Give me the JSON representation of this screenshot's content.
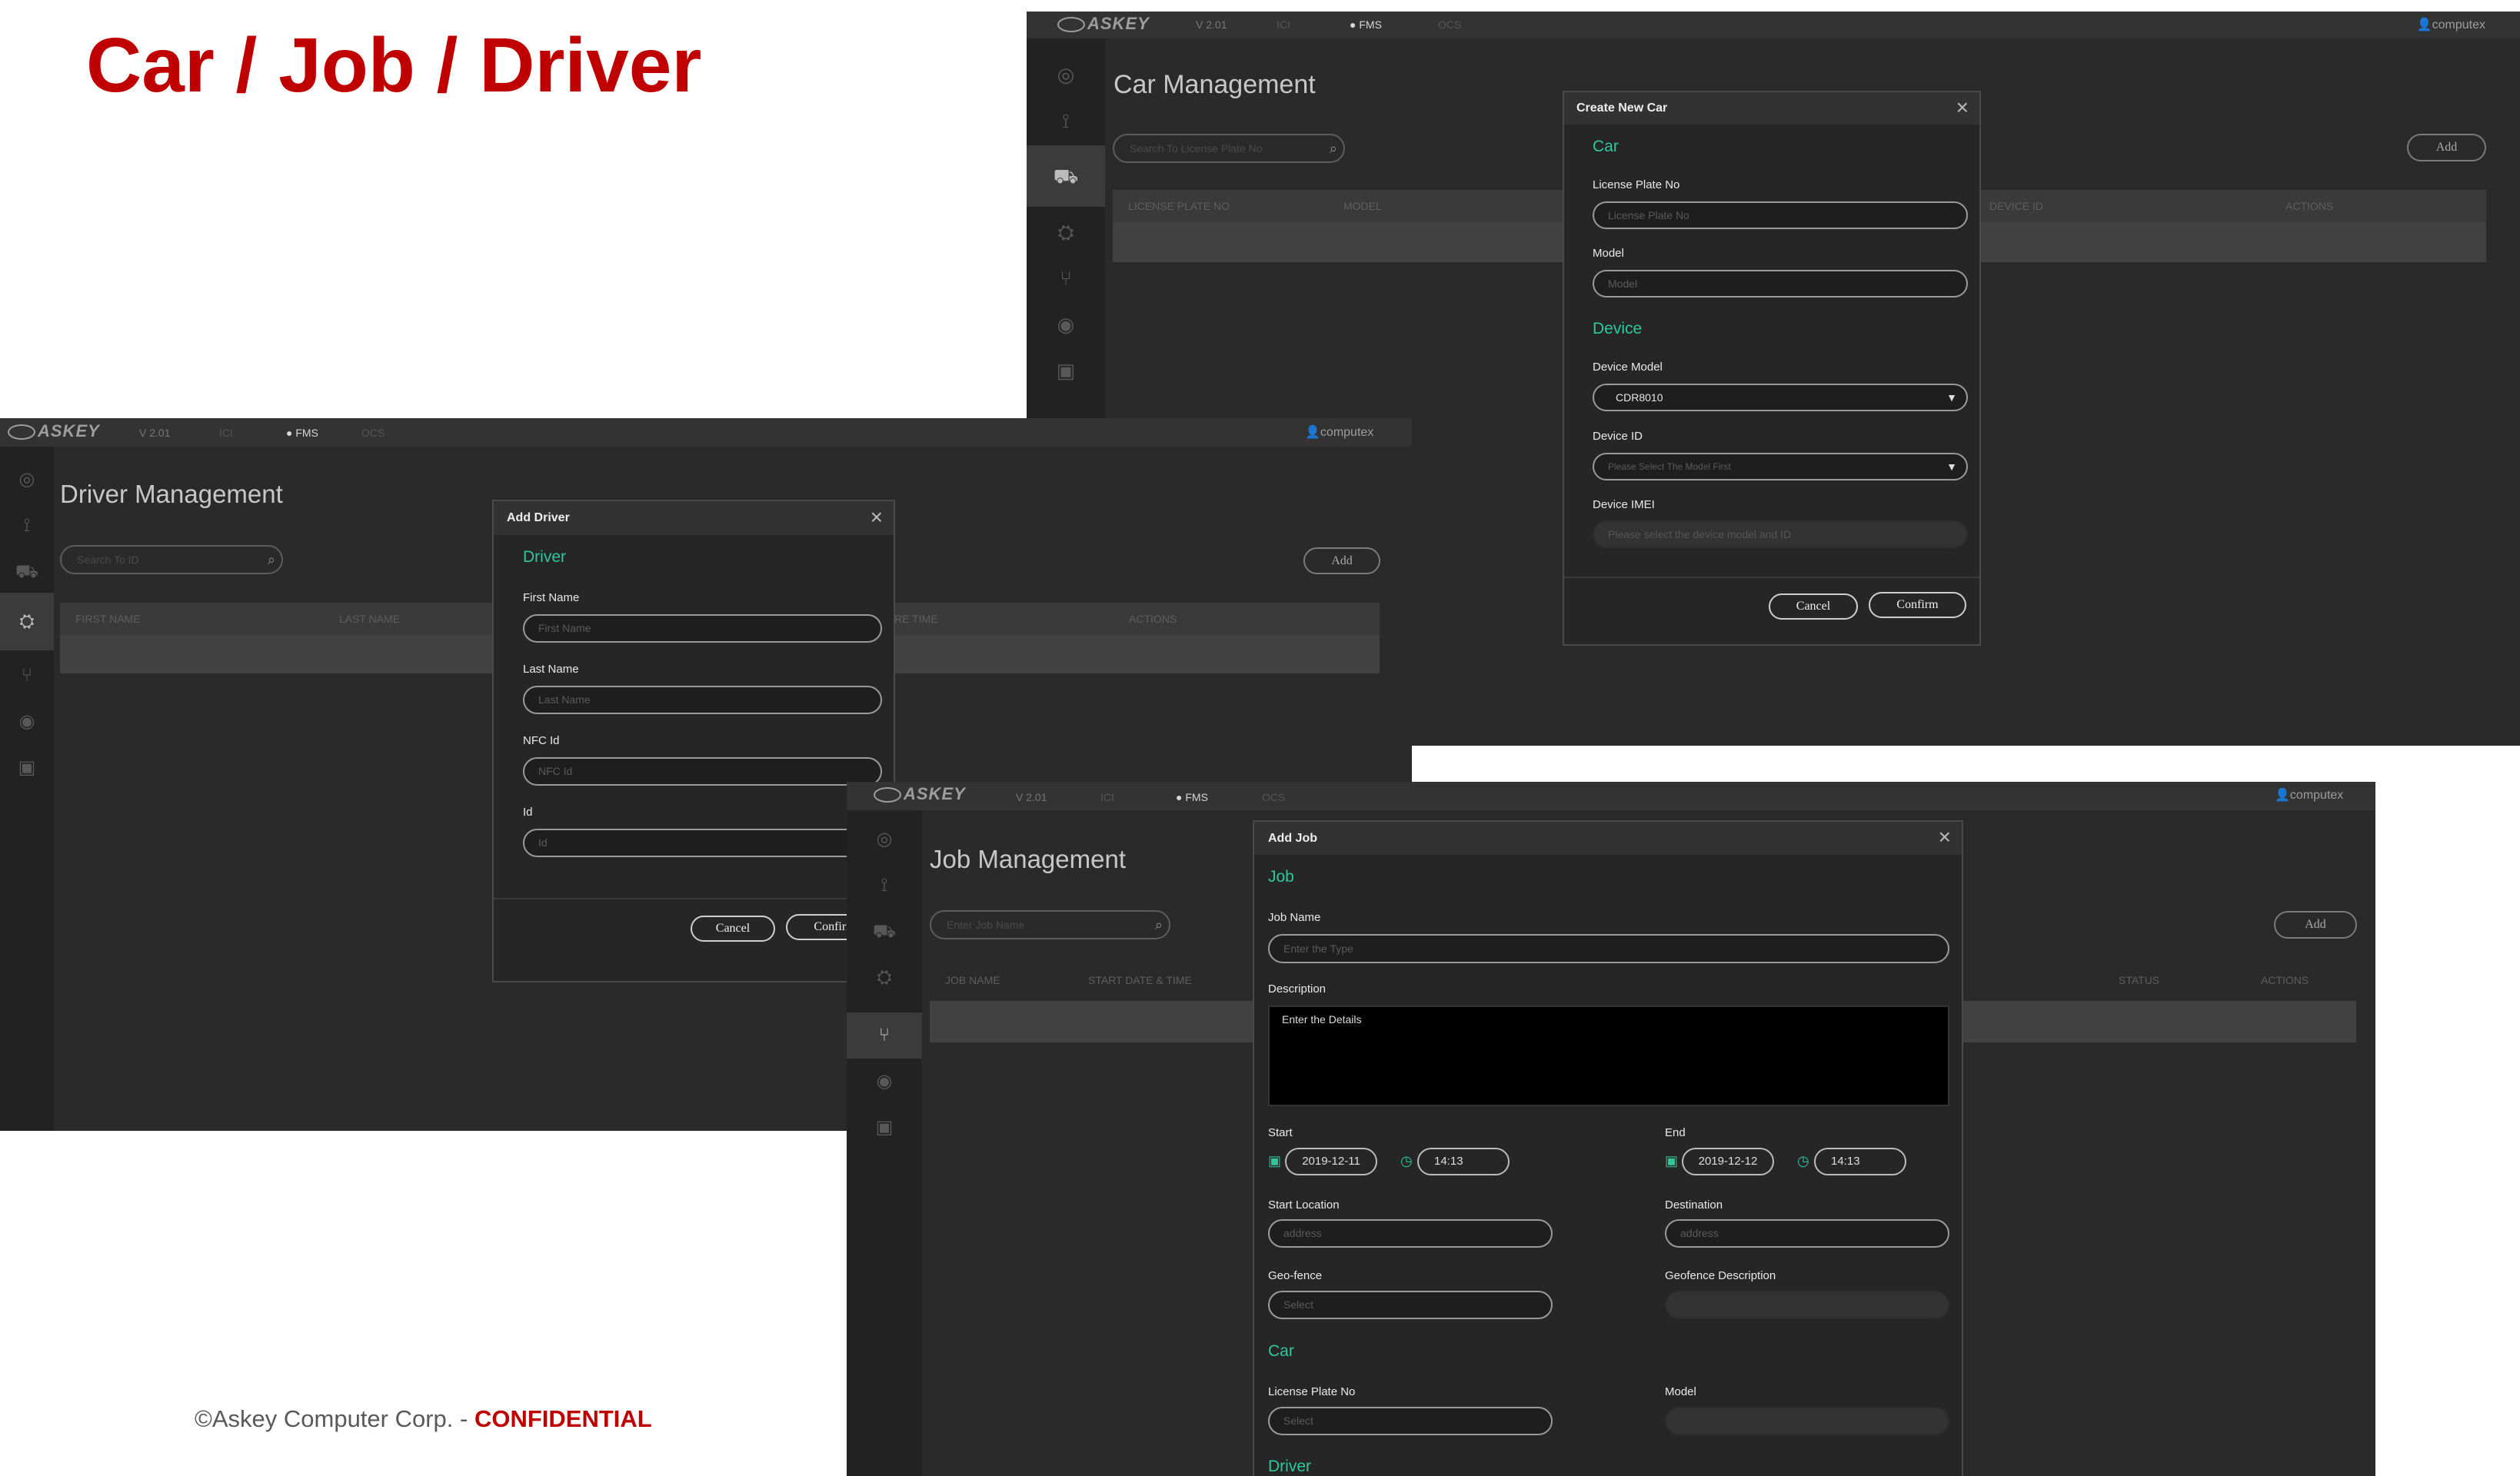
{
  "slide": {
    "title": "Car / Job / Driver",
    "footer_prefix": "©Askey Computer Corp. - ",
    "footer_conf": "CONFIDENTIAL"
  },
  "app": {
    "logo": "ASKEY",
    "version": "V 2.01",
    "tab1": "ICI",
    "tab2": "FMS",
    "tab3": "OCS",
    "user": "computex"
  },
  "icons": {
    "dashboard": "gauge-icon",
    "route": "route-icon",
    "car": "car-icon",
    "driver": "driver-icon",
    "job": "job-icon",
    "eye": "eye-icon",
    "calendar": "calendar-icon"
  },
  "car": {
    "page_title": "Car Management",
    "search_placeholder": "Search To License Plate No",
    "add": "Add",
    "cols": [
      "LICENSE PLATE NO",
      "MODEL",
      "DEVICE ID",
      "ACTIONS"
    ],
    "modal": {
      "title": "Create New Car",
      "sec_car": "Car",
      "lbl_plate": "License Plate No",
      "ph_plate": "License Plate No",
      "lbl_model": "Model",
      "ph_model": "Model",
      "sec_device": "Device",
      "lbl_device_model": "Device Model",
      "device_model": "CDR8010",
      "lbl_device_id": "Device ID",
      "ph_device_id": "Please Select The Model First",
      "lbl_imei": "Device IMEI",
      "ph_imei": "Please select the device model and ID",
      "cancel": "Cancel",
      "confirm": "Confirm"
    }
  },
  "driver": {
    "page_title": "Driver Management",
    "search_placeholder": "Search To ID",
    "add": "Add",
    "cols": [
      "FIRST NAME",
      "LAST NAME",
      "RE TIME",
      "ACTIONS"
    ],
    "modal": {
      "title": "Add Driver",
      "sec": "Driver",
      "lbl_first": "First Name",
      "ph_first": "First Name",
      "lbl_last": "Last Name",
      "ph_last": "Last Name",
      "lbl_nfc": "NFC Id",
      "ph_nfc": "NFC Id",
      "lbl_id": "Id",
      "ph_id": "Id",
      "cancel": "Cancel",
      "confirm": "Confirm"
    }
  },
  "job": {
    "page_title": "Job Management",
    "search_placeholder": "Enter Job Name",
    "add": "Add",
    "cols": [
      "JOB NAME",
      "START DATE & TIME",
      "STATUS",
      "ACTIONS"
    ],
    "modal": {
      "title": "Add Job",
      "sec_job": "Job",
      "lbl_name": "Job Name",
      "ph_name": "Enter the Type",
      "lbl_desc": "Description",
      "ph_desc": "Enter the Details",
      "lbl_start": "Start",
      "start_date": "2019-12-11",
      "start_time": "14:13",
      "lbl_end": "End",
      "end_date": "2019-12-12",
      "end_time": "14:13",
      "lbl_start_loc": "Start Location",
      "ph_start_loc": "address",
      "lbl_dest": "Destination",
      "ph_dest": "address",
      "lbl_geo": "Geo-fence",
      "ph_geo": "Select",
      "lbl_geo_desc": "Geofence Description",
      "sec_car": "Car",
      "lbl_plate": "License Plate No",
      "ph_plate": "Select",
      "lbl_model": "Model",
      "sec_driver": "Driver"
    }
  }
}
